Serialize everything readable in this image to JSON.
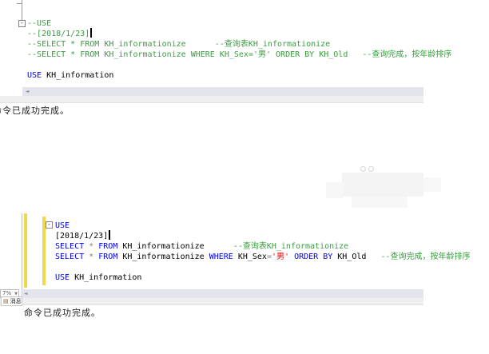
{
  "colors": {
    "comment": "#389e3e",
    "keyword": "#0000ff",
    "string": "#ff0000",
    "operator": "#7f7f7f",
    "plain": "#000000",
    "change_bar": "#f1d74b",
    "scroll_track": "#e4e4ec",
    "tabstrip": "#efefef"
  },
  "icons": {
    "collapse_glyph": "-",
    "scroll_left_glyph": "◄",
    "dropdown_glyph": "▼",
    "messages_glyph": "▤"
  },
  "top_editor": {
    "code_lines": [
      [
        {
          "t": "--USE",
          "c": "comment"
        }
      ],
      [
        {
          "t": "--[2018/1/23]",
          "c": "comment"
        },
        {
          "t": "",
          "c": "cursor"
        }
      ],
      [
        {
          "t": "--SELECT * FROM KH_informationize      --查询表KH_informationize",
          "c": "comment"
        }
      ],
      [
        {
          "t": "--SELECT * FROM KH_informationize WHERE KH_Sex='男' ORDER BY KH_Old   --查询完成，按年龄排序",
          "c": "comment"
        }
      ],
      [],
      [
        {
          "t": "USE",
          "c": "kw"
        },
        {
          "t": " KH_information",
          "c": "plain"
        }
      ]
    ],
    "message": "命令已成功完成。"
  },
  "bottom_editor": {
    "code_lines": [
      [
        {
          "t": "USE",
          "c": "kw"
        }
      ],
      [
        {
          "t": "[2018/1/23]",
          "c": "plain"
        },
        {
          "t": "",
          "c": "cursor"
        }
      ],
      [
        {
          "t": "SELECT",
          "c": "kw"
        },
        {
          "t": " ",
          "c": "plain"
        },
        {
          "t": "*",
          "c": "op"
        },
        {
          "t": " ",
          "c": "plain"
        },
        {
          "t": "FROM",
          "c": "kw"
        },
        {
          "t": " KH_informationize      ",
          "c": "plain"
        },
        {
          "t": "--查询表KH_informationize",
          "c": "comment"
        }
      ],
      [
        {
          "t": "SELECT",
          "c": "kw"
        },
        {
          "t": " ",
          "c": "plain"
        },
        {
          "t": "*",
          "c": "op"
        },
        {
          "t": " ",
          "c": "plain"
        },
        {
          "t": "FROM",
          "c": "kw"
        },
        {
          "t": " KH_informationize ",
          "c": "plain"
        },
        {
          "t": "WHERE",
          "c": "kw"
        },
        {
          "t": " KH_Sex",
          "c": "plain"
        },
        {
          "t": "=",
          "c": "op"
        },
        {
          "t": "'男'",
          "c": "str"
        },
        {
          "t": " ",
          "c": "plain"
        },
        {
          "t": "ORDER BY",
          "c": "kw"
        },
        {
          "t": " KH_Old   ",
          "c": "plain"
        },
        {
          "t": "--查询完成，按年龄排序",
          "c": "comment"
        }
      ],
      [],
      [
        {
          "t": "USE",
          "c": "kw"
        },
        {
          "t": " KH_information",
          "c": "plain"
        }
      ]
    ],
    "zoom_value": "7%",
    "tab_label": "消息",
    "message": "命令已成功完成。"
  }
}
